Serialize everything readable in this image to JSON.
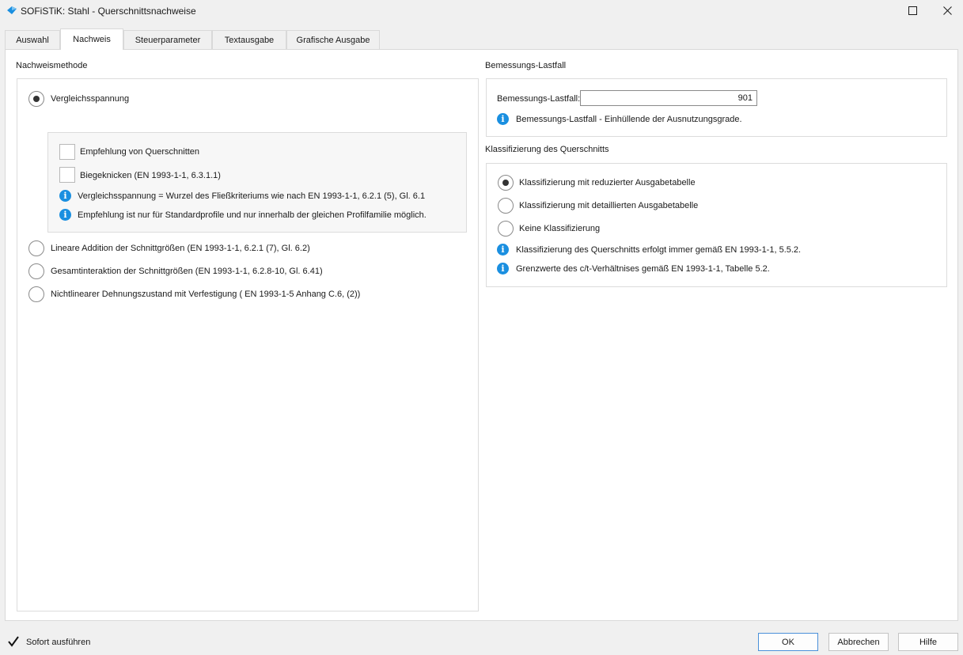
{
  "window": {
    "title": "SOFiSTiK: Stahl - Querschnittsnachweise",
    "brand_color": "#1a8fe0"
  },
  "tabs": [
    {
      "label": "Auswahl",
      "active": false
    },
    {
      "label": "Nachweis",
      "active": true
    },
    {
      "label": "Steuerparameter",
      "active": false
    },
    {
      "label": "Textausgabe",
      "active": false
    },
    {
      "label": "Grafische Ausgabe",
      "active": false
    }
  ],
  "nachweismethode": {
    "heading": "Nachweismethode",
    "selected": "vergleichsspannung",
    "options": {
      "vergleichsspannung": "Vergleichsspannung",
      "lineare_addition": "Lineare Addition der Schnittgrößen (EN 1993-1-1, 6.2.1 (7), Gl. 6.2)",
      "gesamtinteraktion": "Gesamtinteraktion der Schnittgrößen (EN 1993-1-1, 6.2.8-10, Gl. 6.41)",
      "nichtlinear": "Nichtlinearer Dehnungszustand mit Verfestigung ( EN 1993-1-5 Anhang C.6, (2))"
    },
    "sub": {
      "empfehlung": {
        "label": "Empfehlung von Querschnitten",
        "checked": false
      },
      "biegeknicken": {
        "label": "Biegeknicken (EN 1993-1-1, 6.3.1.1)",
        "checked": false
      },
      "info1": "Vergleichsspannung = Wurzel des Fließkriteriums wie nach EN 1993-1-1, 6.2.1 (5), Gl. 6.1",
      "info2": "Empfehlung ist nur für Standardprofile und nur innerhalb der gleichen Profilfamilie möglich."
    }
  },
  "lastfall": {
    "heading": "Bemessungs-Lastfall",
    "field_label": "Bemessungs-Lastfall:",
    "value": "901",
    "info": "Bemessungs-Lastfall - Einhüllende der Ausnutzungsgrade."
  },
  "klassifizierung": {
    "heading": "Klassifizierung des Querschnitts",
    "selected": "reduziert",
    "options": {
      "reduziert": "Klassifizierung mit reduzierter Ausgabetabelle",
      "detailliert": "Klassifizierung mit detaillierten Ausgabetabelle",
      "keine": "Keine Klassifizierung"
    },
    "info1": "Klassifizierung des Querschnitts erfolgt immer gemäß EN 1993-1-1, 5.5.2.",
    "info2": "Grenzwerte des c/t-Verhältnises gemäß EN 1993-1-1, Tabelle 5.2."
  },
  "footer": {
    "sofort_label": "Sofort ausführen",
    "sofort_checked": true,
    "ok": "OK",
    "cancel": "Abbrechen",
    "help": "Hilfe"
  },
  "icons": {
    "info": "info-icon",
    "app": "sofistik-logo-icon",
    "maximize": "maximize-icon",
    "close": "close-icon",
    "check": "checkmark-icon"
  }
}
